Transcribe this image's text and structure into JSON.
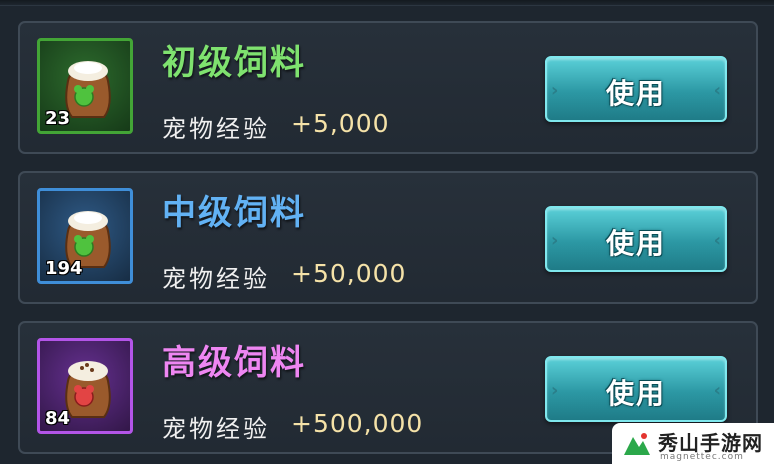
{
  "items": [
    {
      "name": "初级饲料",
      "count": "23",
      "exp_label": "宠物经验",
      "exp_value": "+5,000",
      "button_label": "使用",
      "tier_color": "#7fe26f"
    },
    {
      "name": "中级饲料",
      "count": "194",
      "exp_label": "宠物经验",
      "exp_value": "+50,000",
      "button_label": "使用",
      "tier_color": "#62b2f4"
    },
    {
      "name": "高级饲料",
      "count": "84",
      "exp_label": "宠物经验",
      "exp_value": "+500,000",
      "button_label": "使用",
      "tier_color": "#ee86f2"
    }
  ],
  "icons": {
    "item": "feed-sack-icon",
    "button_decor": "chevron-icon"
  },
  "watermark": {
    "title": "秀山手游网",
    "subtitle": "magnettec.com"
  }
}
